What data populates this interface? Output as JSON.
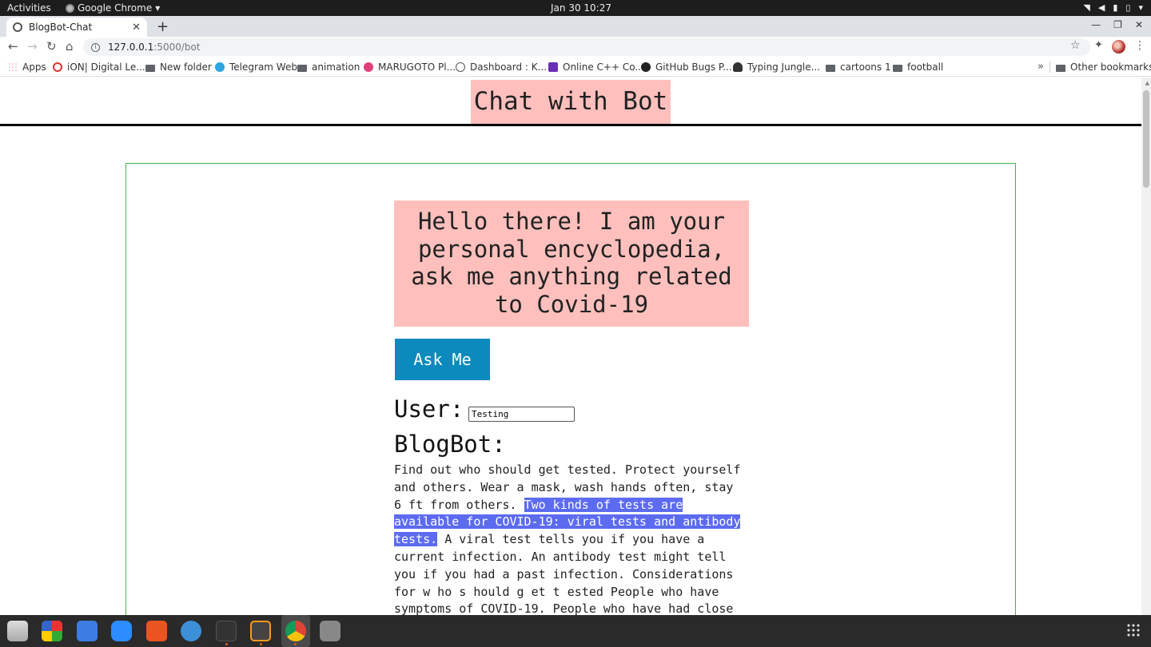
{
  "system_bar": {
    "activities": "Activities",
    "app_name": "Google Chrome",
    "clock": "Jan 30  10:27"
  },
  "browser": {
    "tab_title": "BlogBot-Chat",
    "url_host": "127.0.0.1",
    "url_path": ":5000/bot",
    "bookmarks": [
      "Apps",
      "iON| Digital Le...",
      "New folder",
      "Telegram Web",
      "animation",
      "MARUGOTO Pl...",
      "Dashboard : K...",
      "Online C++ Co...",
      "GitHub Bugs P...",
      "Typing Jungle...",
      "cartoons 1",
      "football"
    ],
    "other_bookmarks": "Other bookmarks"
  },
  "page": {
    "title": "Chat with Bot",
    "greeting": "Hello there! I am your personal encyclopedia, ask me anything related to Covid-19",
    "ask_button": "Ask Me",
    "user_label": "User:",
    "user_input_value": "Testing",
    "bot_label": "BlogBot:",
    "reply_before": "Find out who should get tested. Protect yourself and others. Wear a mask, wash hands often, stay 6 ft from others. ",
    "reply_selected": "Two kinds of tests are available for COVID-19: viral tests and antibody tests.",
    "reply_after": " A viral test tells you if you have a current infection. An antibody test might tell you if you had a past infection. Considerations for w ho s hould g et t ested People who have symptoms of COVID-19. People who have had close contact",
    "colors": {
      "title_bg": "#ffc0bd",
      "button_bg": "#0a8abd",
      "box_border": "#4caf50",
      "selection": "#5c6bf0"
    }
  }
}
